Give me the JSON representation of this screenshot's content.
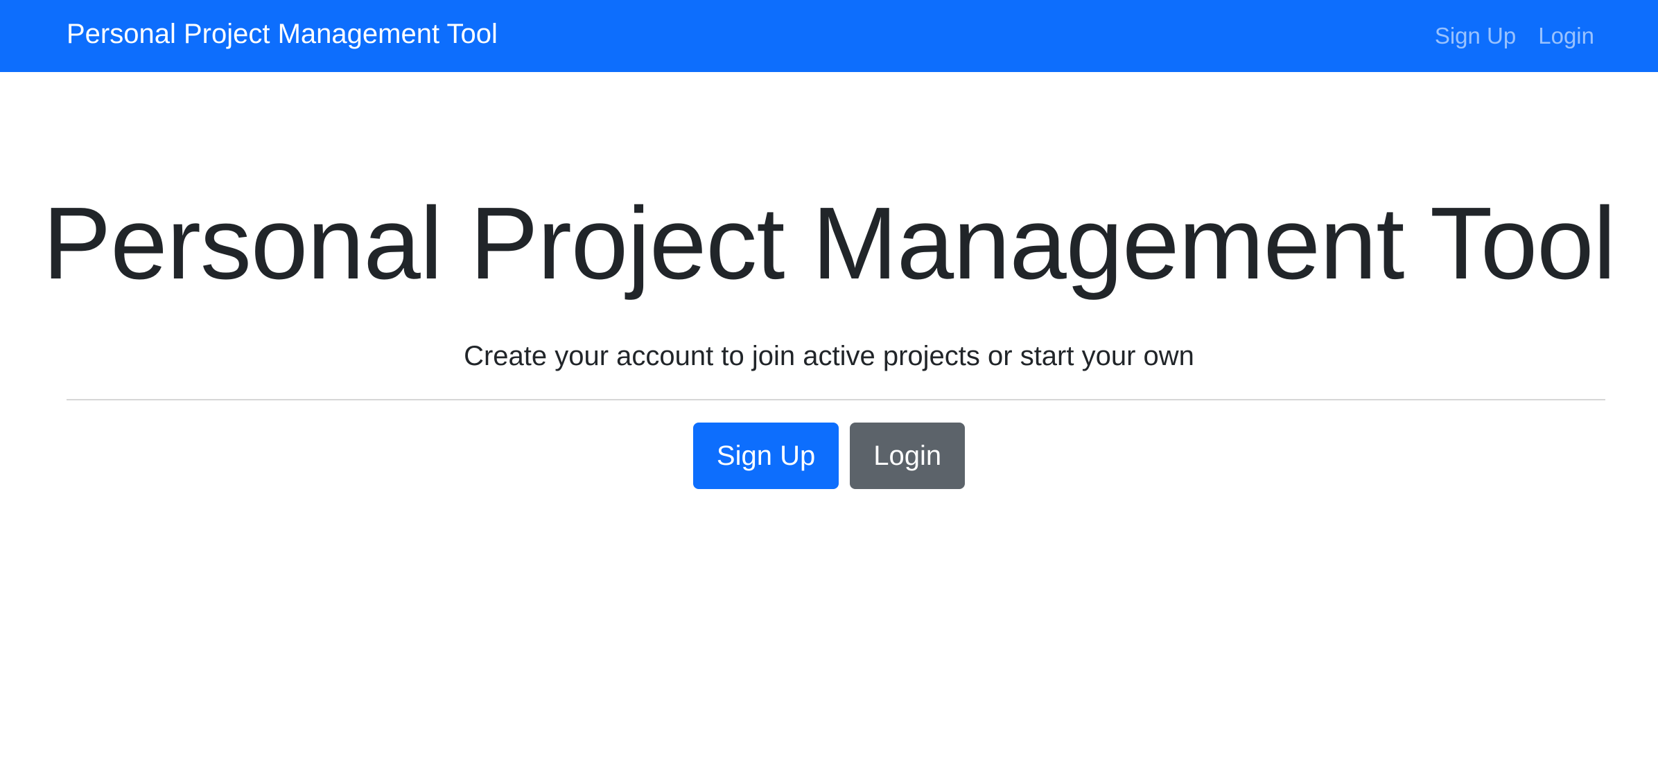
{
  "navbar": {
    "brand": "Personal Project Management Tool",
    "links": [
      {
        "label": "Sign Up"
      },
      {
        "label": "Login"
      }
    ]
  },
  "hero": {
    "title": "Personal Project Management Tool",
    "lead": "Create your account to join active projects or start your own",
    "buttons": [
      {
        "label": "Sign Up",
        "style": "primary"
      },
      {
        "label": "Login",
        "style": "secondary"
      }
    ]
  },
  "colors": {
    "primary": "#0d6efd",
    "secondary": "#5c636a",
    "text": "#212529"
  }
}
